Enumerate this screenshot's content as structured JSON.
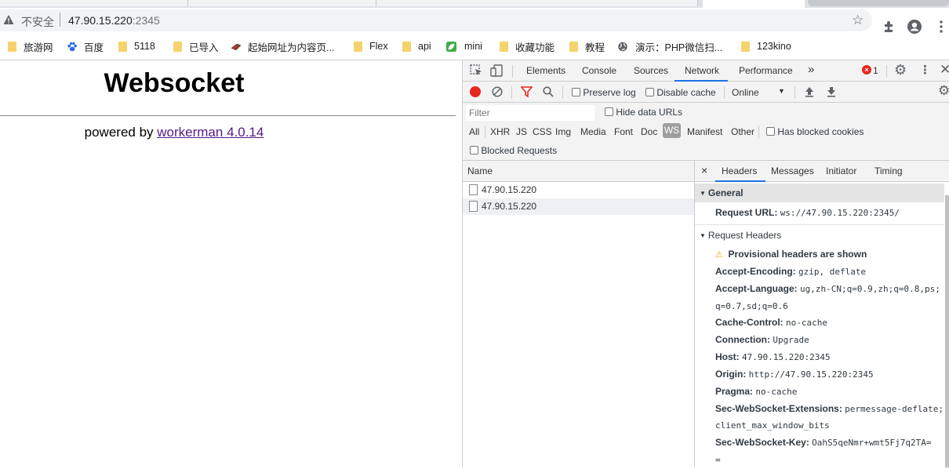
{
  "browser": {
    "security_label": "不安全",
    "url_host": "47.90.15.220",
    "url_port": ":2345"
  },
  "bookmarks": [
    {
      "label": "旅游网",
      "icon": "folder-icon"
    },
    {
      "label": "百度",
      "icon": "baidu-paw-icon"
    },
    {
      "label": "5118",
      "icon": "folder-icon"
    },
    {
      "label": "已导入",
      "icon": "folder-icon"
    },
    {
      "label": "起始网址为内容页...",
      "icon": "site-favicon-icon"
    },
    {
      "label": "Flex",
      "icon": "folder-icon"
    },
    {
      "label": "api",
      "icon": "folder-icon"
    },
    {
      "label": "mini",
      "icon": "leaf-icon"
    },
    {
      "label": "收藏功能",
      "icon": "folder-icon"
    },
    {
      "label": "教程",
      "icon": "folder-icon"
    },
    {
      "label": "演示：PHP微信扫...",
      "icon": "globe-icon"
    },
    {
      "label": "123kino",
      "icon": "folder-icon"
    }
  ],
  "page": {
    "title": "Websocket",
    "powered_prefix": "powered by ",
    "powered_link": "workerman 4.0.14"
  },
  "devtools": {
    "tabs": [
      "Elements",
      "Console",
      "Sources",
      "Network",
      "Performance"
    ],
    "active_tab": "Network",
    "more_tabs": "»",
    "error_count": "1",
    "toolbar": {
      "preserve_log": "Preserve log",
      "disable_cache": "Disable cache",
      "throttle": "Online"
    },
    "filter": {
      "placeholder": "Filter",
      "hide_data_urls": "Hide data URLs",
      "types": [
        "All",
        "XHR",
        "JS",
        "CSS",
        "Img",
        "Media",
        "Font",
        "Doc",
        "WS",
        "Manifest",
        "Other"
      ],
      "active_type": "WS",
      "has_blocked_cookies": "Has blocked cookies",
      "blocked_requests": "Blocked Requests"
    },
    "requests": {
      "column_name": "Name",
      "rows": [
        "47.90.15.220",
        "47.90.15.220"
      ]
    },
    "detail": {
      "close": "×",
      "tabs": [
        "Headers",
        "Messages",
        "Initiator",
        "Timing"
      ],
      "active_tab": "Headers",
      "general_title": "General",
      "request_url_label": "Request URL:",
      "request_url_value": "ws://47.90.15.220:2345/",
      "request_headers_title": "Request Headers",
      "provisional_warning": "Provisional headers are shown",
      "headers": [
        {
          "name": "Accept-Encoding:",
          "value": "gzip, deflate"
        },
        {
          "name": "Accept-Language:",
          "value": "ug,zh-CN;q=0.9,zh;q=0.8,ps;",
          "value2": "q=0.7,sd;q=0.6"
        },
        {
          "name": "Cache-Control:",
          "value": "no-cache"
        },
        {
          "name": "Connection:",
          "value": "Upgrade"
        },
        {
          "name": "Host:",
          "value": "47.90.15.220:2345"
        },
        {
          "name": "Origin:",
          "value": "http://47.90.15.220:2345"
        },
        {
          "name": "Pragma:",
          "value": "no-cache"
        },
        {
          "name": "Sec-WebSocket-Extensions:",
          "value": "permessage-deflate;",
          "value2": "client_max_window_bits"
        },
        {
          "name": "Sec-WebSocket-Key:",
          "value": "OahS5qeNmr+wmt5Fj7q2TA=",
          "value2": "="
        }
      ]
    }
  },
  "colors": {
    "accent": "#1a73e8",
    "record": "#e8271c",
    "link": "#551a8b",
    "folder": "#f5d26b",
    "warning": "#f2c200"
  }
}
